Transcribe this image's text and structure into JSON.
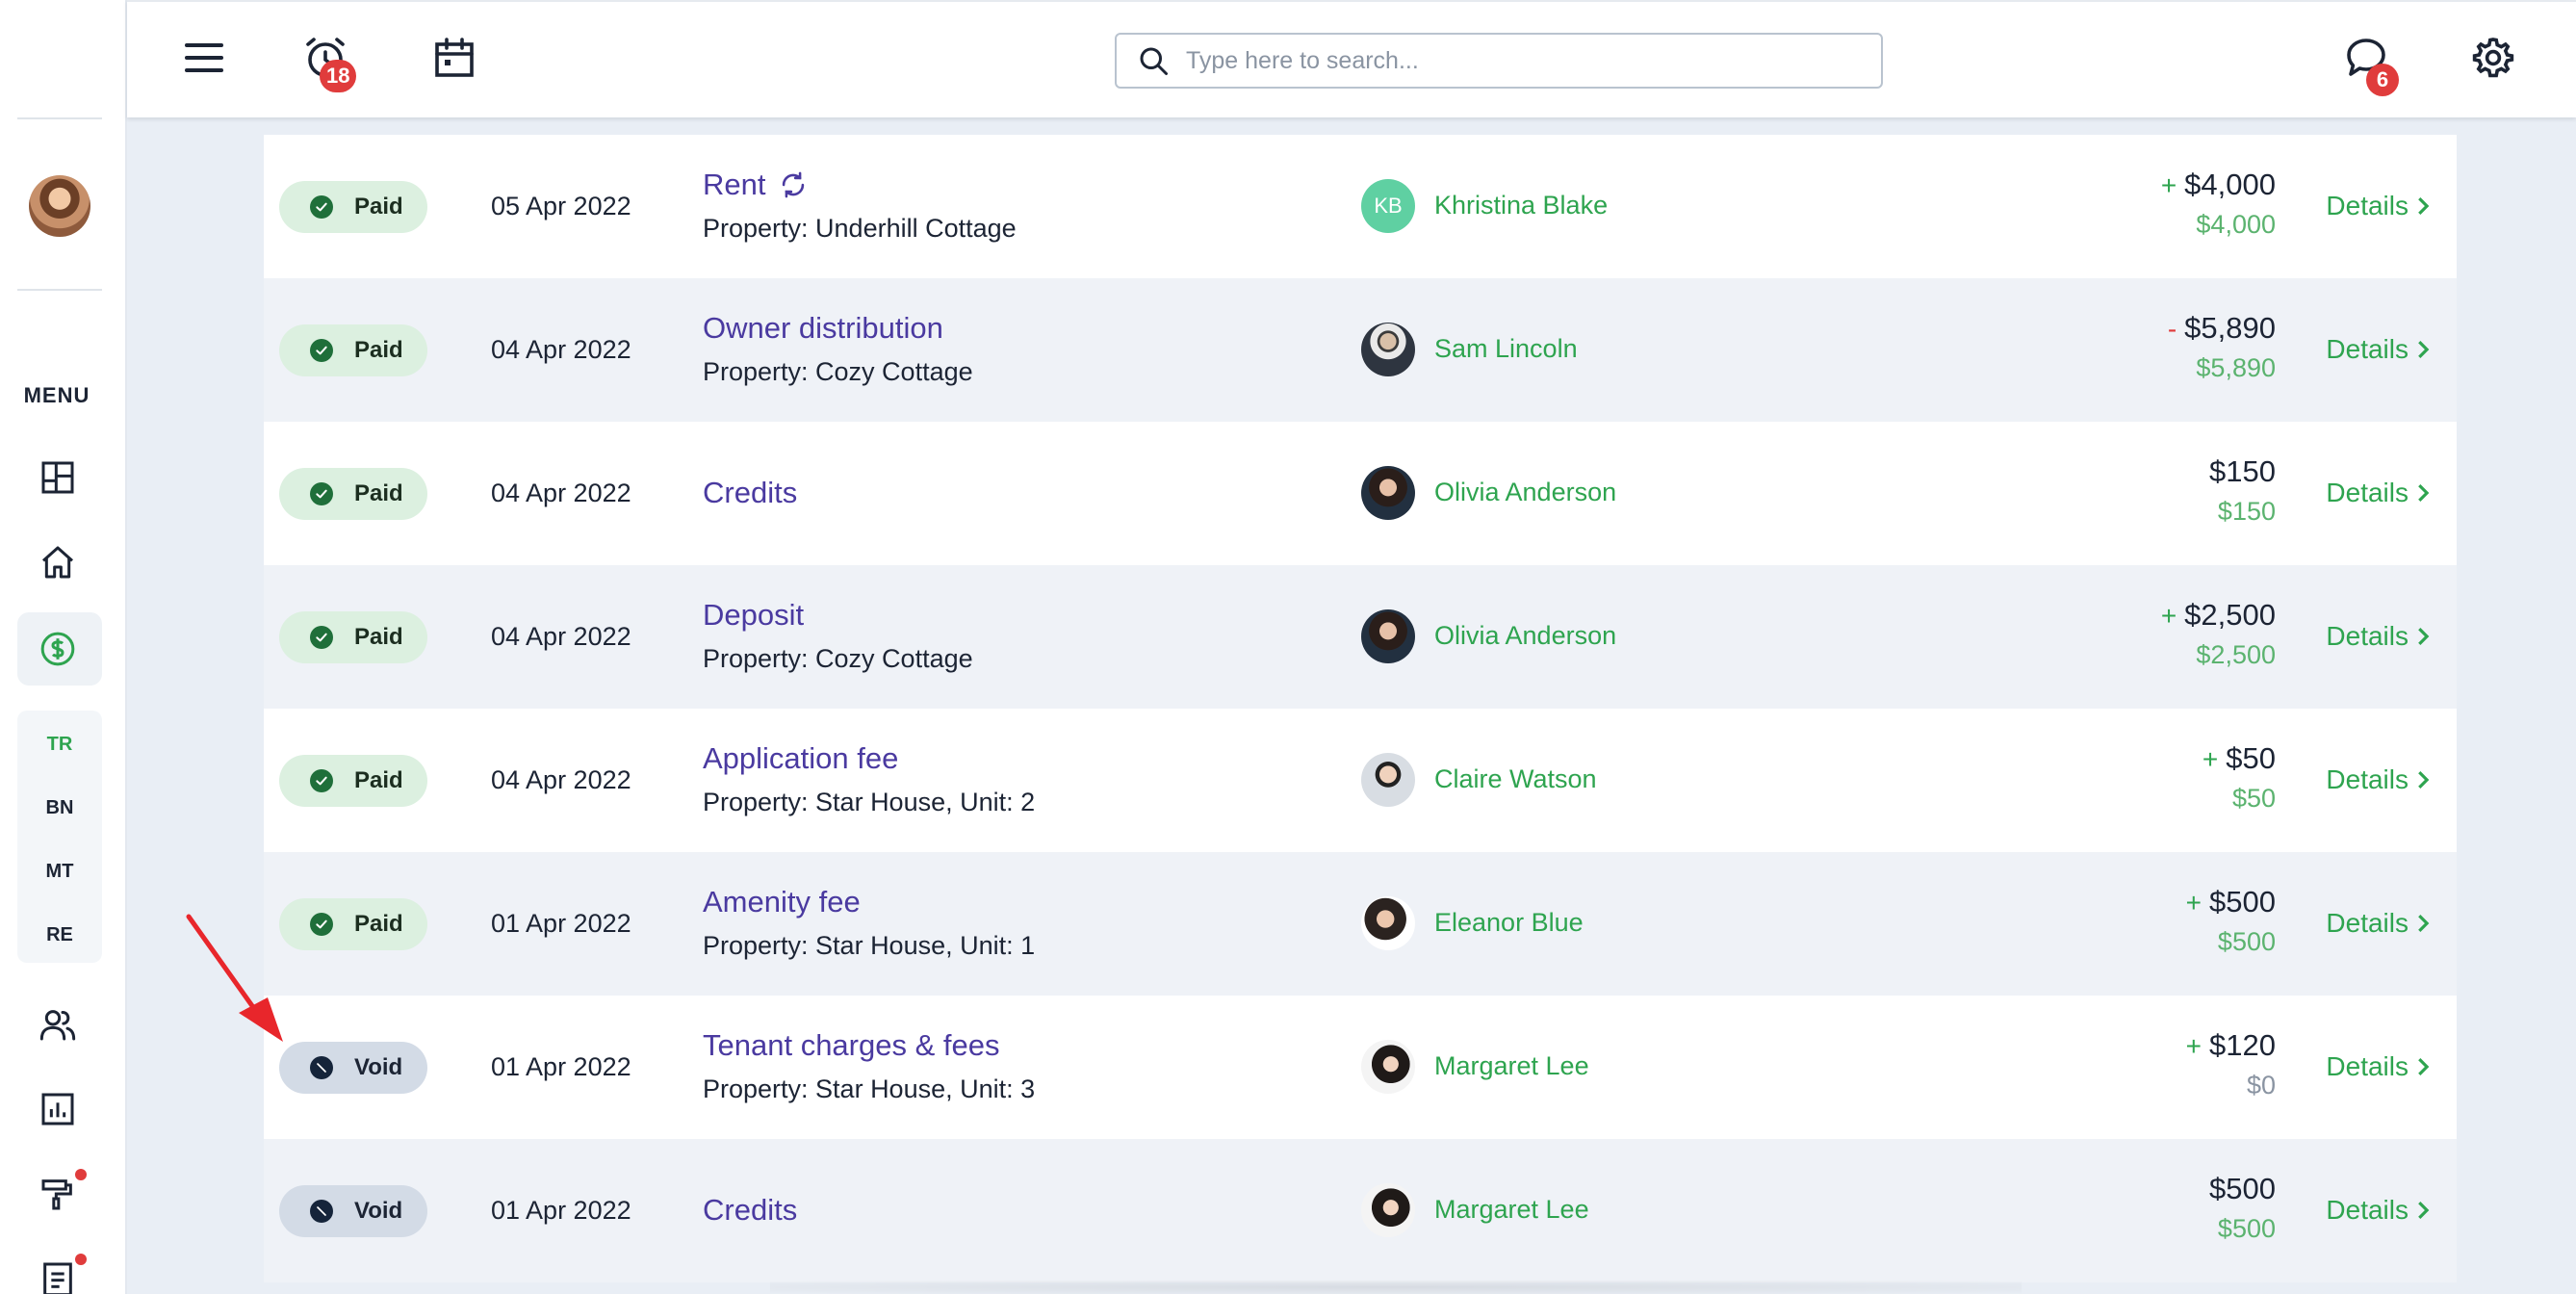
{
  "header": {
    "search_placeholder": "Type here to search...",
    "alerts_count": "18",
    "messages_count": "6"
  },
  "sidebar": {
    "menu_label": "MENU",
    "sub_items": [
      "TR",
      "BN",
      "MT",
      "RE"
    ]
  },
  "colors": {
    "accent_green": "#2ea44f",
    "title_purple": "#4a3aa0",
    "badge_red": "#e03c3c"
  },
  "transactions": [
    {
      "status": "Paid",
      "date": "05 Apr 2022",
      "title": "Rent",
      "property": "Property: Underhill Cottage",
      "person": "Khristina Blake",
      "initials": "KB",
      "sign": "+",
      "amount": "$4,000",
      "paid": "$4,000"
    },
    {
      "status": "Paid",
      "date": "04 Apr 2022",
      "title": "Owner distribution",
      "property": "Property: Cozy Cottage",
      "person": "Sam Lincoln",
      "sign": "-",
      "amount": "$5,890",
      "paid": "$5,890"
    },
    {
      "status": "Paid",
      "date": "04 Apr 2022",
      "title": "Credits",
      "property": "",
      "person": "Olivia Anderson",
      "sign": "",
      "amount": "$150",
      "paid": "$150"
    },
    {
      "status": "Paid",
      "date": "04 Apr 2022",
      "title": "Deposit",
      "property": "Property: Cozy Cottage",
      "person": "Olivia Anderson",
      "sign": "+",
      "amount": "$2,500",
      "paid": "$2,500"
    },
    {
      "status": "Paid",
      "date": "04 Apr 2022",
      "title": "Application fee",
      "property": "Property: Star House, Unit: 2",
      "person": "Claire Watson",
      "sign": "+",
      "amount": "$50",
      "paid": "$50"
    },
    {
      "status": "Paid",
      "date": "01 Apr 2022",
      "title": "Amenity fee",
      "property": "Property: Star House, Unit: 1",
      "person": "Eleanor Blue",
      "sign": "+",
      "amount": "$500",
      "paid": "$500"
    },
    {
      "status": "Void",
      "date": "01 Apr 2022",
      "title": "Tenant charges & fees",
      "property": "Property: Star House, Unit: 3",
      "person": "Margaret Lee",
      "sign": "+",
      "amount": "$120",
      "paid": "$0"
    },
    {
      "status": "Void",
      "date": "01 Apr 2022",
      "title": "Credits",
      "property": "",
      "person": "Margaret Lee",
      "sign": "",
      "amount": "$500",
      "paid": "$500"
    }
  ],
  "details_label": "Details"
}
